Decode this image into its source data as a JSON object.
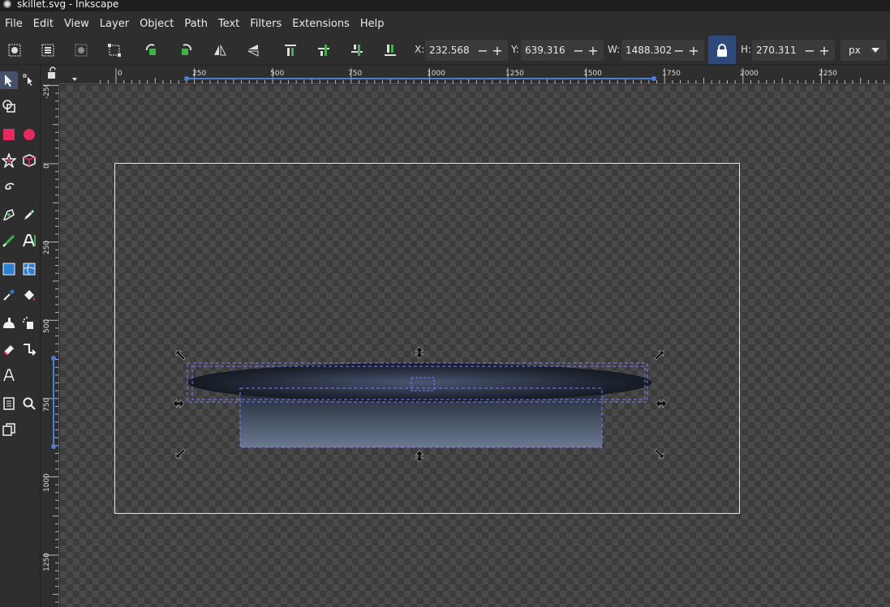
{
  "window": {
    "title": "skillet.svg - Inkscape"
  },
  "menu": [
    "File",
    "Edit",
    "View",
    "Layer",
    "Object",
    "Path",
    "Text",
    "Filters",
    "Extensions",
    "Help"
  ],
  "toolbar": {
    "x_label": "X:",
    "x_value": "232.568",
    "y_label": "Y:",
    "y_value": "639.316",
    "w_label": "W:",
    "w_value": "1488.302",
    "h_label": "H:",
    "h_value": "270.311",
    "unit": "px",
    "minus": "−",
    "plus": "+"
  },
  "ruler_h": [
    "0",
    "250",
    "500",
    "750",
    "1000",
    "1250",
    "1500",
    "1750",
    "2000",
    "2250"
  ],
  "ruler_v": [
    "-250",
    "0",
    "250",
    "500",
    "750",
    "1000",
    "1250"
  ],
  "colors": {
    "accent": "#2e4a7a",
    "selection": "#7d7dff",
    "toolbox_red": "#e8295e",
    "toolbox_green": "#3db34a"
  }
}
